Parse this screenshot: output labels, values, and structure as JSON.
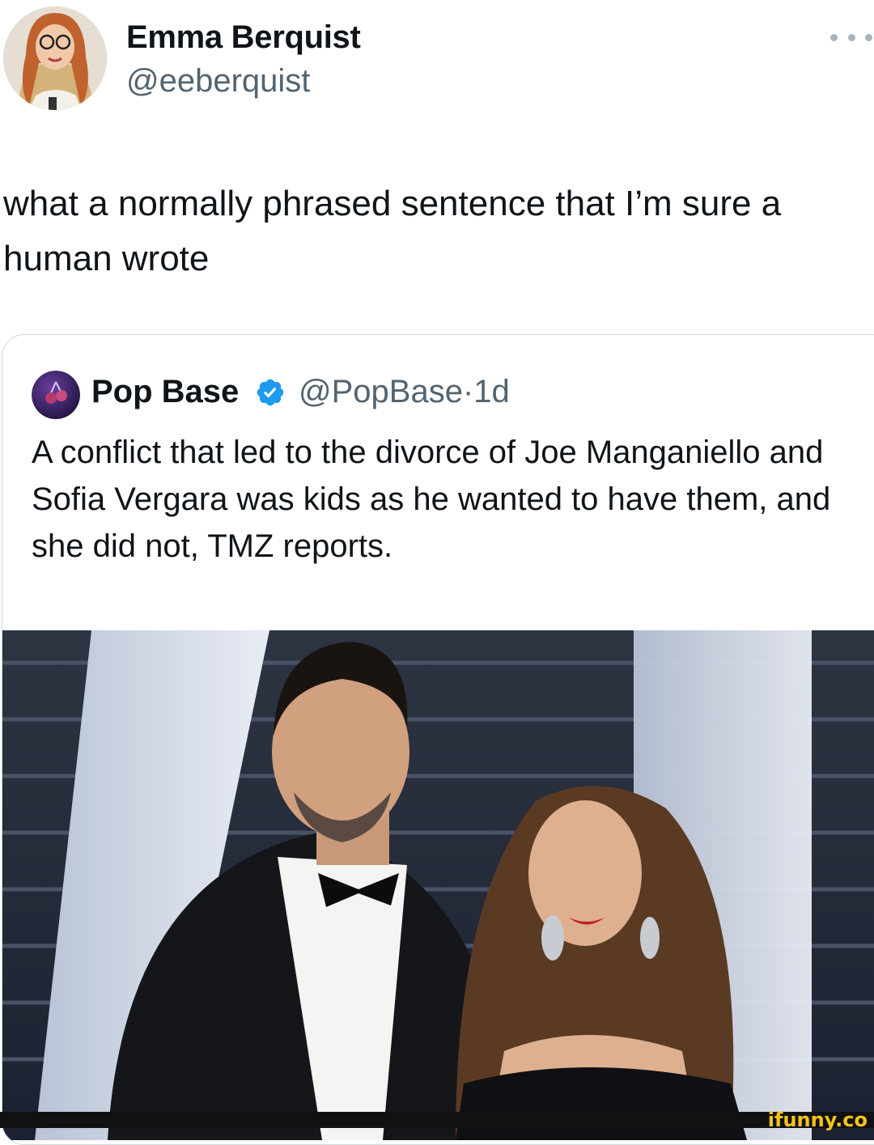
{
  "author": {
    "name": "Emma Berquist",
    "handle": "@eeberquist",
    "avatar_icon": "profile-photo"
  },
  "more_icon": "ellipsis-icon",
  "tweet": {
    "text": "what a normally phrased sentence that I’m sure a human wrote"
  },
  "quoted": {
    "name": "Pop Base",
    "handle": "@PopBase",
    "separator": "·",
    "time": "1d",
    "verified_color": "#1d9bf0",
    "text": "A conflict that led to the divorce of Joe Manganiello and Sofia Vergara was kids as he wanted to have them, and she did not, TMZ reports.",
    "photo_icon": "photo-image"
  },
  "watermark": "ifunny.co",
  "colors": {
    "text": "#0f1419",
    "secondary": "#536471",
    "border": "#cfd9de",
    "accent": "#1d9bf0"
  }
}
